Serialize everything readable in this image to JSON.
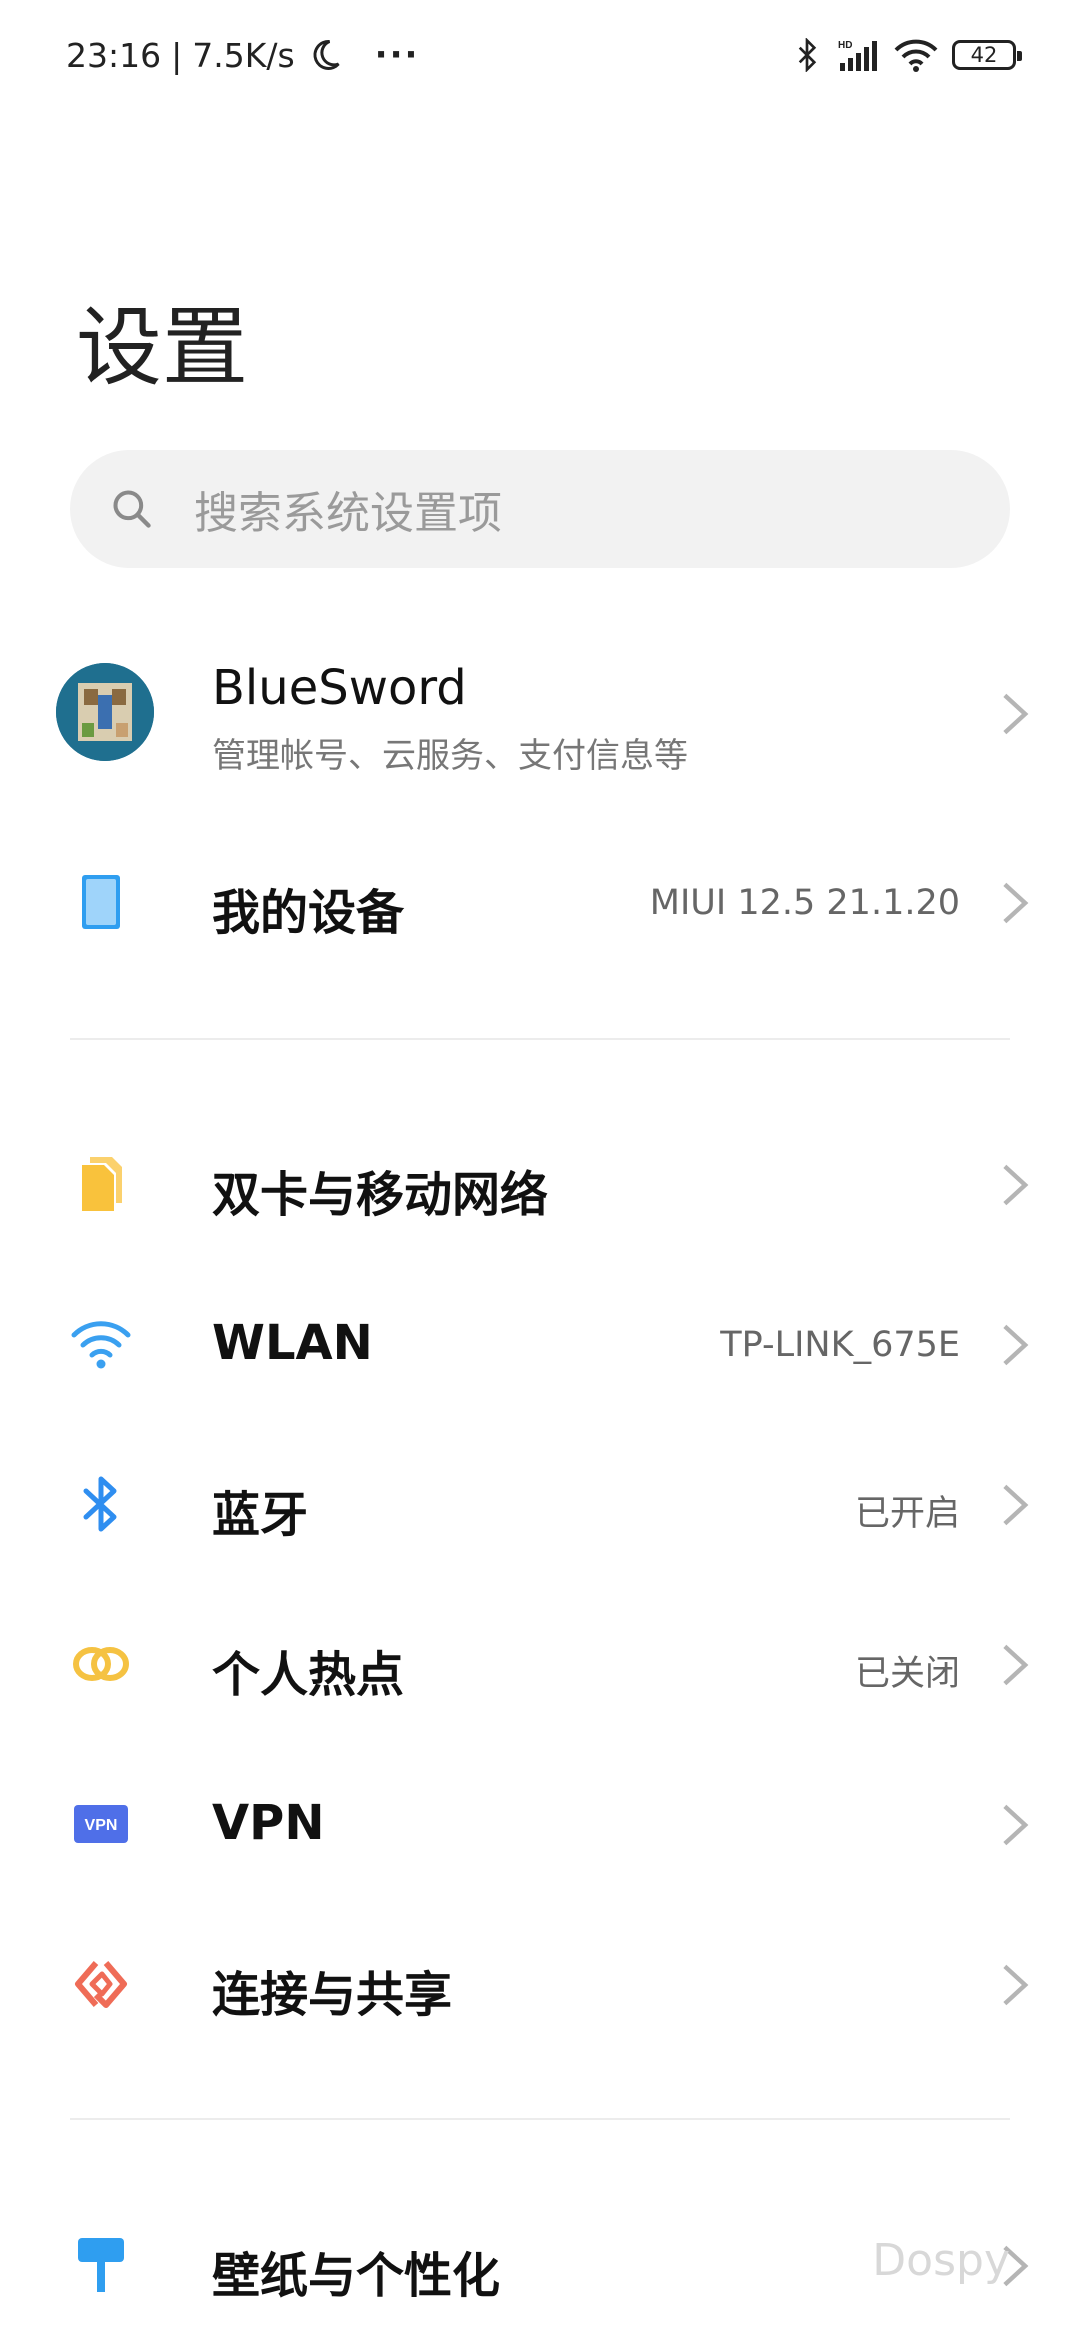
{
  "status_bar": {
    "time": "23:16",
    "separator": "|",
    "net_speed": "7.5K/s",
    "more": "···",
    "battery": "42"
  },
  "page": {
    "title": "设置"
  },
  "search": {
    "placeholder": "搜索系统设置项"
  },
  "account": {
    "name": "BlueSword",
    "subtitle": "管理帐号、云服务、支付信息等"
  },
  "device": {
    "label": "我的设备",
    "value": "MIUI 12.5 21.1.20"
  },
  "network_items": [
    {
      "label": "双卡与移动网络",
      "value": "",
      "icon": "sim-card-icon"
    },
    {
      "label": "WLAN",
      "value": "TP-LINK_675E",
      "icon": "wifi-icon"
    },
    {
      "label": "蓝牙",
      "value": "已开启",
      "icon": "bluetooth-icon"
    },
    {
      "label": "个人热点",
      "value": "已关闭",
      "icon": "hotspot-icon"
    },
    {
      "label": "VPN",
      "value": "",
      "icon": "vpn-icon"
    },
    {
      "label": "连接与共享",
      "value": "",
      "icon": "connection-share-icon"
    }
  ],
  "personalization_items": [
    {
      "label": "壁纸与个性化",
      "icon": "wallpaper-icon"
    }
  ],
  "watermark": "Dospy",
  "colors": {
    "sim": "#f9c23c",
    "wifi": "#3aa0f0",
    "bluetooth": "#2f8ef0",
    "hotspot": "#f5c242",
    "vpn": "#4f6fe8",
    "share": "#ef6c57",
    "device": "#7cc4f4",
    "wallpaper": "#2f9ef0"
  }
}
